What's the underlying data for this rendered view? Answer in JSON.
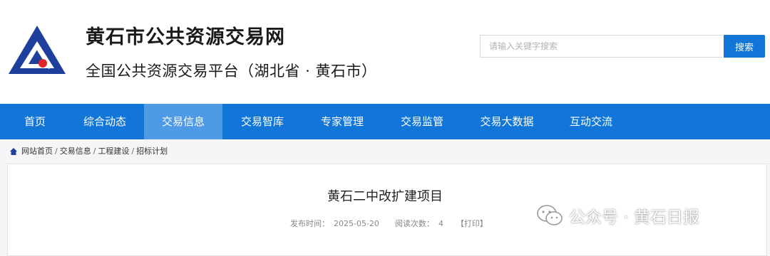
{
  "header": {
    "site_title": "黄石市公共资源交易网",
    "site_subtitle": "全国公共资源交易平台（湖北省 · 黄石市）",
    "logo_icon": "triangle-logo-icon"
  },
  "search": {
    "placeholder": "请输入关键字搜索",
    "button_label": "搜索"
  },
  "nav": {
    "items": [
      {
        "label": "首页"
      },
      {
        "label": "综合动态"
      },
      {
        "label": "交易信息"
      },
      {
        "label": "交易智库"
      },
      {
        "label": "专家管理"
      },
      {
        "label": "交易监管"
      },
      {
        "label": "交易大数据"
      },
      {
        "label": "互动交流"
      }
    ],
    "active": "交易信息"
  },
  "breadcrumb": {
    "icon": "home-icon",
    "items": [
      "网站首页",
      "交易信息",
      "工程建设",
      "招标计划"
    ],
    "separator": "/"
  },
  "article": {
    "title": "黄石二中改扩建项目",
    "publish_label": "发布时间：",
    "publish_date": "2025-05-20",
    "views_label": "阅读次数：",
    "views": "4",
    "print_label": "【打印】"
  },
  "watermark": {
    "icon": "wechat-icon",
    "text": "公众号 · 黄石日报"
  },
  "colors": {
    "brand_blue": "#1276d8",
    "nav_active": "#4e9ae5",
    "logo_blue": "#1f3f9c",
    "logo_red": "#e0262b"
  }
}
